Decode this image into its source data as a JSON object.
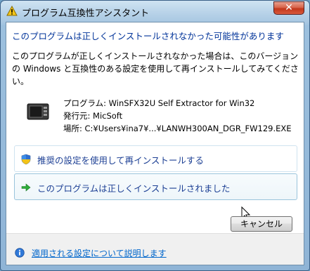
{
  "window": {
    "title": "プログラム互換性アシスタント",
    "close_glyph": "✕"
  },
  "heading": "このプログラムは正しくインストールされなかった可能性があります",
  "description": "このプログラムが正しくインストールされなかった場合は、このバージョンの Windows と互換性のある設定を使用して再インストールしてみてください。",
  "program": {
    "name_line": "プログラム: WinSFX32U Self Extractor for Win32",
    "publisher_line": "発行元: MicSoft",
    "location_line": "場所: C:¥Users¥ina7¥...¥LANWH300AN_DGR_FW129.EXE"
  },
  "options": [
    {
      "label": "推奨の設定を使用して再インストールする",
      "icon": "uac-shield-icon"
    },
    {
      "label": "このプログラムは正しくインストールされました",
      "icon": "green-arrow-icon"
    }
  ],
  "buttons": {
    "cancel": "キャンセル"
  },
  "help_link": "適用される設定について説明します",
  "colors": {
    "heading": "#003399",
    "link": "#0066cc",
    "command_link": "#1c3f94",
    "close_button": "#c2371b"
  }
}
